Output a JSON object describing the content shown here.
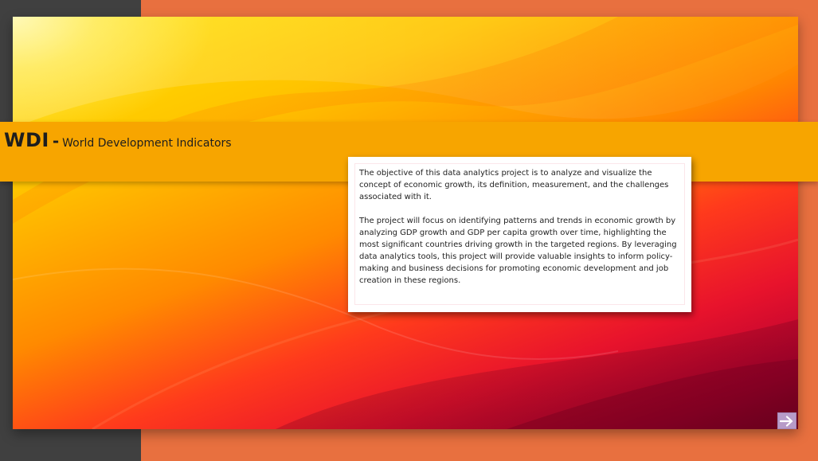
{
  "banner": {
    "abbreviation": "WDI",
    "separator": "-",
    "title": "World Development Indicators"
  },
  "description": {
    "paragraphs": [
      "The objective of this data analytics project is to analyze and visualize the concept of economic growth, its definition, measurement, and the challenges associated with it.",
      "The project will focus on identifying patterns and trends in economic growth by analyzing GDP growth and GDP per capita growth over time, highlighting the most significant countries driving growth in the targeted regions. By leveraging data analytics tools, this project will provide valuable insights to inform policy-making and business decisions for promoting economic development and job creation in these regions."
    ]
  },
  "navigation": {
    "next_icon": "arrow-right-icon"
  },
  "colors": {
    "background": "#e8703f",
    "left_strip": "#404040",
    "banner": "#f7a500",
    "next_button": "#b79bc8"
  }
}
